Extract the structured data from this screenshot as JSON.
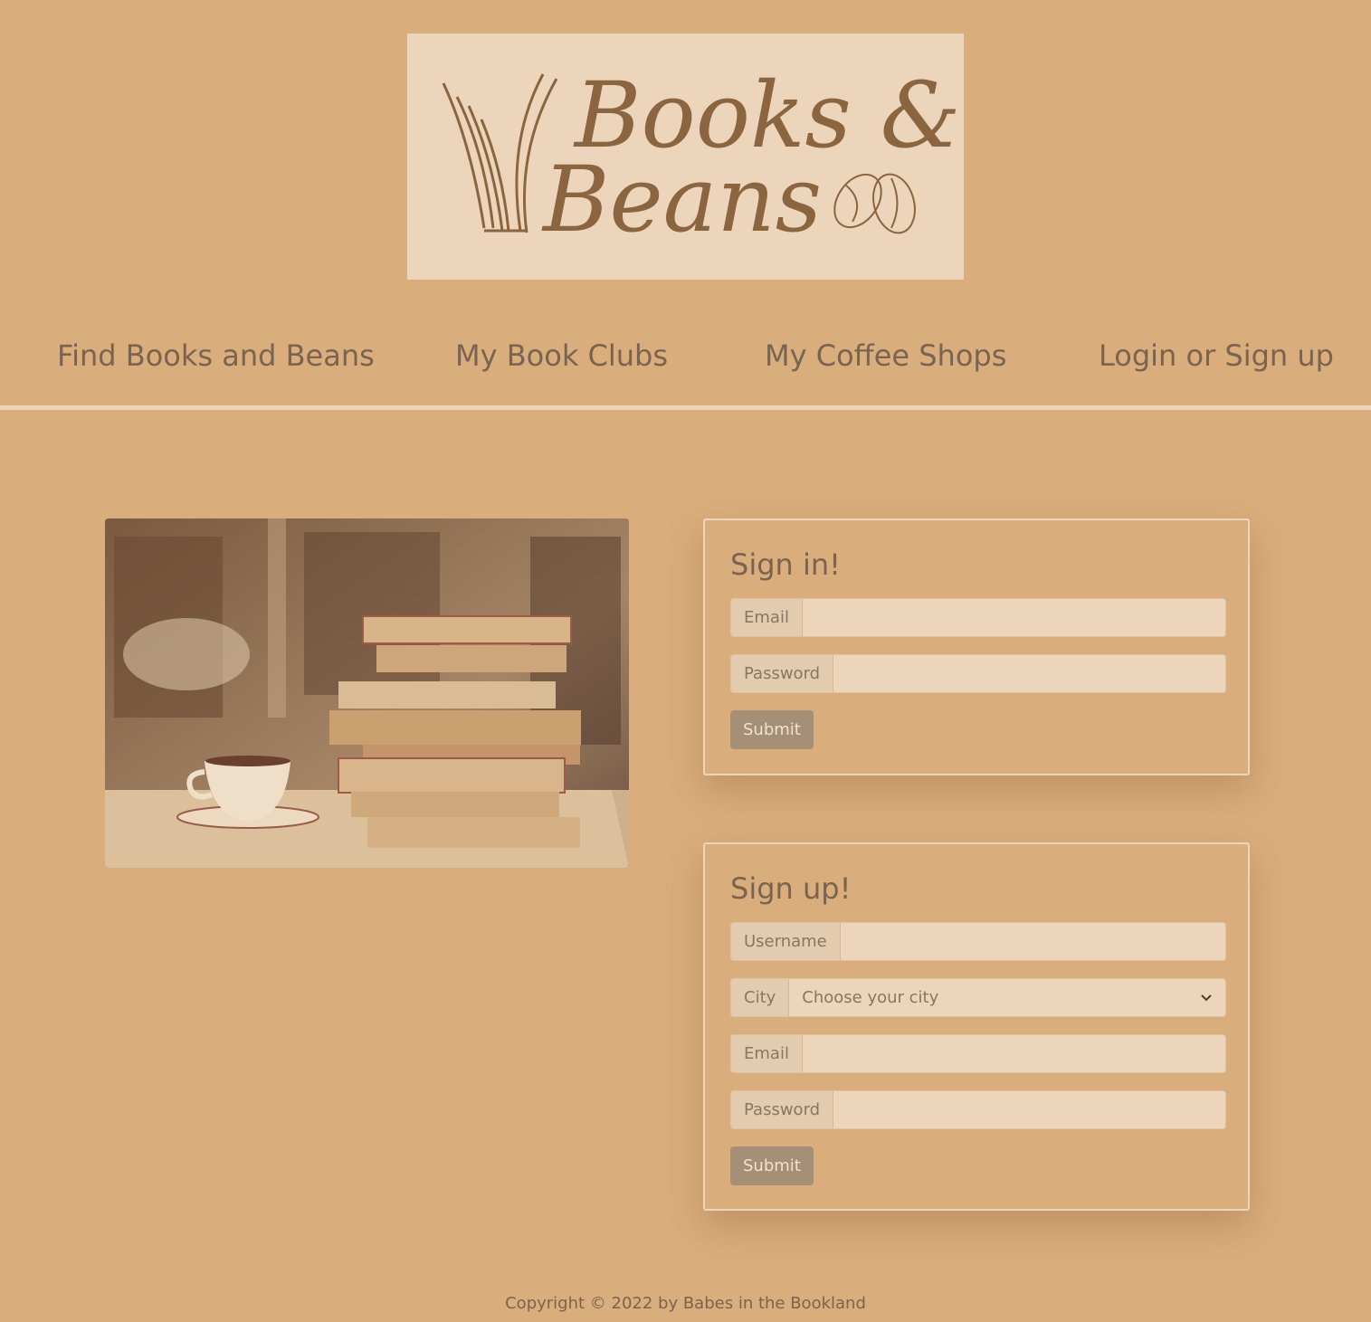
{
  "logo": {
    "line1": "Books &",
    "line2": "Beans"
  },
  "nav": {
    "items": [
      {
        "label": "Find Books and Beans"
      },
      {
        "label": "My Book Clubs"
      },
      {
        "label": "My Coffee Shops"
      },
      {
        "label": "Login or Sign up"
      }
    ]
  },
  "hero": {
    "icon": "books-and-coffee-photo"
  },
  "signin": {
    "title": "Sign in!",
    "email_label": "Email",
    "password_label": "Password",
    "email_value": "",
    "password_value": "",
    "submit_label": "Submit"
  },
  "signup": {
    "title": "Sign up!",
    "username_label": "Username",
    "city_label": "City",
    "city_selected": "Choose your city",
    "email_label": "Email",
    "password_label": "Password",
    "username_value": "",
    "email_value": "",
    "password_value": "",
    "submit_label": "Submit"
  },
  "footer": {
    "text": "Copyright © 2022 by Babes in the Bookland"
  },
  "colors": {
    "background": "#d9ad7c",
    "panel": "#ecd5bb",
    "logo_ink": "#8a6540",
    "button": "#a68f77"
  }
}
